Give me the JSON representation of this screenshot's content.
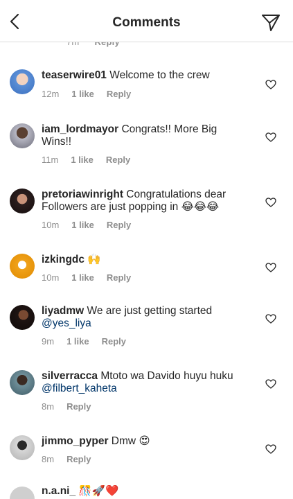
{
  "header": {
    "title": "Comments",
    "back_icon": "chevron-left-icon",
    "send_icon": "paper-plane-icon"
  },
  "partial_top": {
    "time": "7m",
    "reply": "Reply"
  },
  "comments": [
    {
      "username": "teaserwire01",
      "text": "Welcome to the crew",
      "time": "12m",
      "likes": "1 like",
      "reply": "Reply",
      "avatar_color": "#5b8fd6"
    },
    {
      "username": "iam_lordmayor",
      "text": "Congrats!! More Big Wins!!",
      "time": "11m",
      "likes": "1 like",
      "reply": "Reply",
      "avatar_color": "#7a7a86"
    },
    {
      "username": "pretoriawinright",
      "text": "Congratulations dear Followers are just popping in",
      "emoji": "😂😂😂",
      "time": "10m",
      "likes": "1 like",
      "reply": "Reply",
      "avatar_color": "#3a2a2a"
    },
    {
      "username": "izkingdc",
      "text": "",
      "emoji": "🙌",
      "time": "10m",
      "likes": "1 like",
      "reply": "Reply",
      "avatar_color": "#f0a21a"
    },
    {
      "username": "liyadmw",
      "text": "We are just getting started",
      "mention": "@yes_liya",
      "time": "9m",
      "likes": "1 like",
      "reply": "Reply",
      "avatar_color": "#2a1a16"
    },
    {
      "username": "silverracca",
      "text": "Mtoto wa Davido huyu huku",
      "mention": "@filbert_kaheta",
      "time": "8m",
      "likes": "",
      "reply": "Reply",
      "avatar_color": "#4a6b7a"
    },
    {
      "username": "jimmo_pyper",
      "text": "Dmw",
      "emoji": "😍",
      "time": "8m",
      "likes": "",
      "reply": "Reply",
      "avatar_color": "#9a9a9a"
    }
  ],
  "partial_bottom": {
    "username": "n.a.ni_",
    "emoji": "🎊🚀❤️"
  }
}
